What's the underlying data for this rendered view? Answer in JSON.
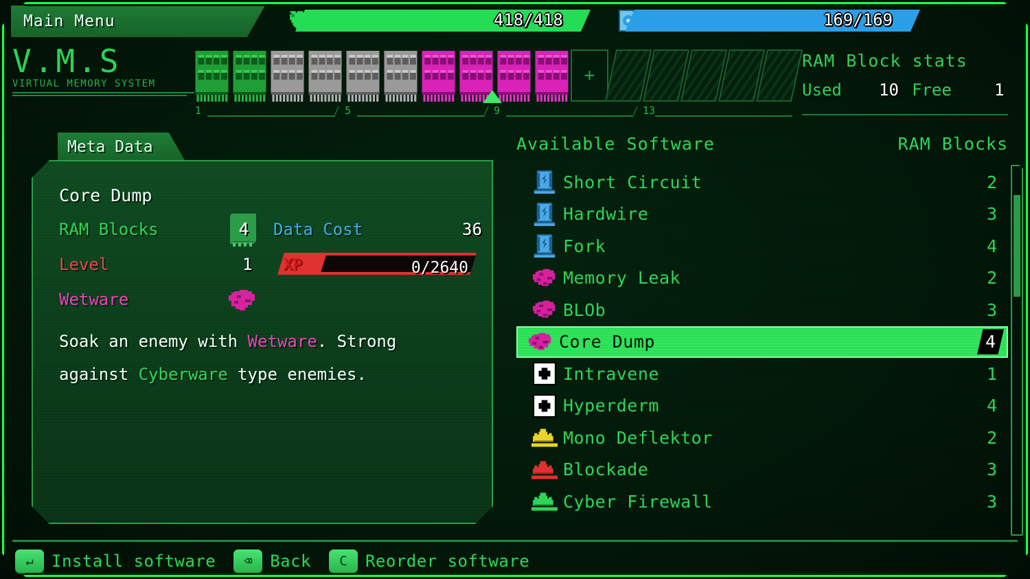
{
  "window": {
    "menu_label": "Main Menu"
  },
  "status": {
    "health": {
      "icon": "heart-icon",
      "value": "418/418",
      "fill_percent": 100,
      "color": "#25dd55"
    },
    "data": {
      "icon": "data-disk-icon",
      "value": "169/169",
      "fill_percent": 100,
      "color": "#2a9fe8"
    }
  },
  "logo": {
    "title": "V.M.S",
    "subtitle": "VIRTUAL MEMORY SYSTEM"
  },
  "ram_strip": {
    "slots": [
      {
        "type": "filled",
        "color": "green"
      },
      {
        "type": "filled",
        "color": "green"
      },
      {
        "type": "filled",
        "color": "grey"
      },
      {
        "type": "filled",
        "color": "grey"
      },
      {
        "type": "filled",
        "color": "grey"
      },
      {
        "type": "filled",
        "color": "grey"
      },
      {
        "type": "filled",
        "color": "magenta"
      },
      {
        "type": "filled",
        "color": "magenta"
      },
      {
        "type": "filled",
        "color": "magenta"
      },
      {
        "type": "filled",
        "color": "magenta"
      },
      {
        "type": "empty",
        "label": "+"
      },
      {
        "type": "locked"
      },
      {
        "type": "locked"
      },
      {
        "type": "locked"
      },
      {
        "type": "locked"
      },
      {
        "type": "locked"
      }
    ],
    "scale_ticks": [
      "1",
      "5",
      "9",
      "13"
    ],
    "cursor_slot": 10
  },
  "ram_stats": {
    "title": "RAM Block stats",
    "used_label": "Used",
    "used_value": "10",
    "free_label": "Free",
    "free_value": "1"
  },
  "meta_panel": {
    "tab_label": "Meta Data",
    "name": "Core Dump",
    "ram_blocks_label": "RAM Blocks",
    "ram_blocks_value": "4",
    "data_cost_label": "Data Cost",
    "data_cost_value": "36",
    "level_label": "Level",
    "level_value": "1",
    "xp_tag": "XP",
    "xp_value": "0/2640",
    "xp_percent": 0,
    "type_label": "Wetware",
    "type_icon": "brain-icon",
    "description": {
      "part1": "Soak an enemy with ",
      "highlight1": "Wetware",
      "part2": ". Strong against ",
      "highlight2": "Cyberware",
      "part3": " type enemies."
    }
  },
  "software_list": {
    "header_name": "Available Software",
    "header_blocks": "RAM Blocks",
    "items": [
      {
        "icon": "chip-icon",
        "icon_color": "#4aa8e8",
        "name": "Short Circuit",
        "blocks": "2",
        "selected": false
      },
      {
        "icon": "chip-icon",
        "icon_color": "#4aa8e8",
        "name": "Hardwire",
        "blocks": "3",
        "selected": false
      },
      {
        "icon": "chip-icon",
        "icon_color": "#4aa8e8",
        "name": "Fork",
        "blocks": "4",
        "selected": false
      },
      {
        "icon": "brain-icon",
        "icon_color": "#d6219f",
        "name": "Memory Leak",
        "blocks": "2",
        "selected": false
      },
      {
        "icon": "brain-icon",
        "icon_color": "#d6219f",
        "name": "BLOb",
        "blocks": "3",
        "selected": false
      },
      {
        "icon": "brain-icon",
        "icon_color": "#d6219f",
        "name": "Core Dump",
        "blocks": "4",
        "selected": true
      },
      {
        "icon": "medkit-icon",
        "icon_color": "#ffffff",
        "name": "Intravene",
        "blocks": "1",
        "selected": false
      },
      {
        "icon": "medkit-icon",
        "icon_color": "#ffffff",
        "name": "Hyperderm",
        "blocks": "4",
        "selected": false
      },
      {
        "icon": "crown-icon",
        "icon_color": "#ead42a",
        "name": "Mono Deflektor",
        "blocks": "2",
        "selected": false
      },
      {
        "icon": "crown-icon",
        "icon_color": "#e03030",
        "name": "Blockade",
        "blocks": "3",
        "selected": false
      },
      {
        "icon": "crown-icon",
        "icon_color": "#2fd557",
        "name": "Cyber Firewall",
        "blocks": "3",
        "selected": false
      }
    ]
  },
  "footer": {
    "hints": [
      {
        "key": "↵",
        "key_name": "enter-key",
        "label": "Install software"
      },
      {
        "key": "⌫",
        "key_name": "backspace-key",
        "label": "Back"
      },
      {
        "key": "C",
        "key_name": "c-key",
        "label": "Reorder software"
      }
    ]
  },
  "colors": {
    "accent_green": "#2fd557",
    "bright_green": "#2ae055",
    "panel_green": "#0e4a20",
    "magenta": "#d6219f",
    "blue": "#3da9e8",
    "red": "#e03030",
    "background": "#021a0a"
  }
}
